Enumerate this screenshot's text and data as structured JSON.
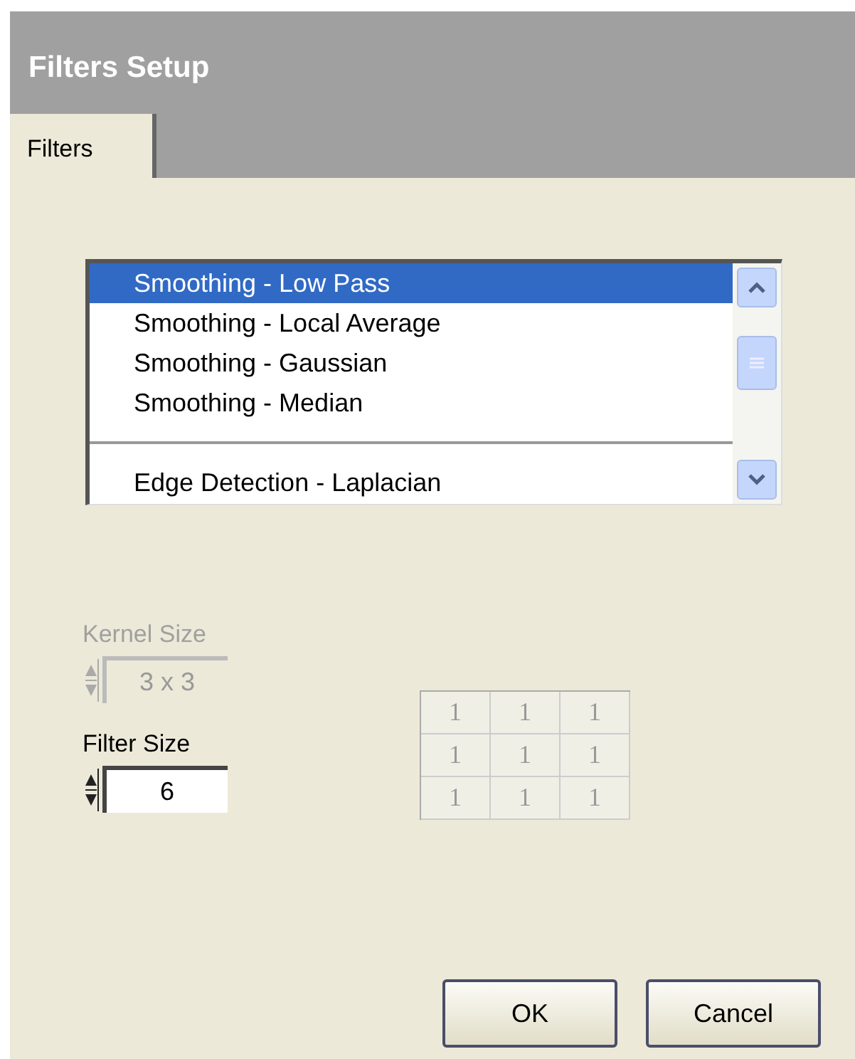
{
  "window": {
    "title": "Filters Setup"
  },
  "tabs": [
    {
      "label": "Filters",
      "selected": true
    }
  ],
  "filter_list": {
    "items": [
      {
        "kind": "item",
        "label": "Smoothing - Low Pass",
        "selected": true
      },
      {
        "kind": "item",
        "label": "Smoothing - Local Average",
        "selected": false
      },
      {
        "kind": "item",
        "label": "Smoothing - Gaussian",
        "selected": false
      },
      {
        "kind": "item",
        "label": "Smoothing - Median",
        "selected": false
      },
      {
        "kind": "separator"
      },
      {
        "kind": "item",
        "label": "Edge Detection - Laplacian",
        "selected": false
      }
    ]
  },
  "kernel_size": {
    "label": "Kernel Size",
    "value": "3 x 3",
    "disabled": true
  },
  "filter_size": {
    "label": "Filter Size",
    "value": "6",
    "disabled": false
  },
  "kernel": {
    "disabled": true,
    "rows": [
      [
        "1",
        "1",
        "1"
      ],
      [
        "1",
        "1",
        "1"
      ],
      [
        "1",
        "1",
        "1"
      ]
    ]
  },
  "buttons": [
    "OK",
    "Cancel"
  ]
}
